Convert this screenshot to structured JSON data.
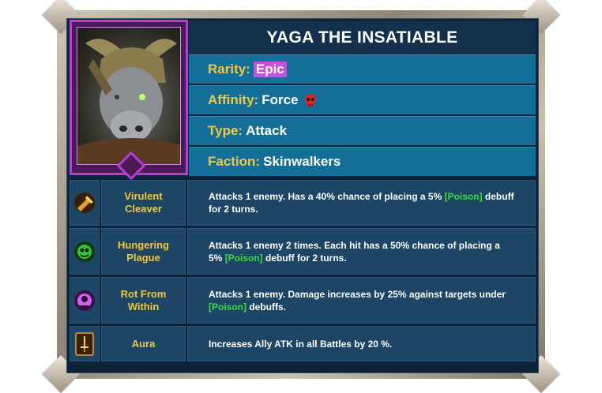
{
  "champion": {
    "name": "YAGA THE INSATIABLE",
    "rarity_label": "Rarity:",
    "rarity": "Epic",
    "affinity_label": "Affinity:",
    "affinity": "Force",
    "affinity_icon": "red-skull-icon",
    "type_label": "Type:",
    "type": "Attack",
    "faction_label": "Faction:",
    "faction": "Skinwalkers"
  },
  "colors": {
    "rarity_epic": "#c84fe0",
    "label_gold": "#f0c744",
    "poison_green": "#3ddc3d",
    "row_blue": "#136f98"
  },
  "skills": [
    {
      "name_line1": "Virulent",
      "name_line2": "Cleaver",
      "icon": "cleaver-icon",
      "desc_pre": "Attacks 1 enemy. Has a 40% chance of placing a 5% ",
      "desc_tag": "[Poison]",
      "desc_post": " debuff for 2 turns."
    },
    {
      "name_line1": "Hungering",
      "name_line2": "Plague",
      "icon": "plague-icon",
      "desc_pre": "Attacks 1 enemy 2 times. Each hit has a 50% chance of placing a 5% ",
      "desc_tag": "[Poison]",
      "desc_post": " debuff for 2 turns."
    },
    {
      "name_line1": "Rot From",
      "name_line2": "Within",
      "icon": "rot-icon",
      "desc_pre": "Attacks 1 enemy. Damage increases by 25% against targets under ",
      "desc_tag": "[Poison]",
      "desc_post": " debuffs."
    },
    {
      "name_line1": "Aura",
      "name_line2": "",
      "icon": "sword-aura-icon",
      "desc_pre": "Increases Ally ATK in all Battles by 20 %.",
      "desc_tag": "",
      "desc_post": ""
    }
  ]
}
